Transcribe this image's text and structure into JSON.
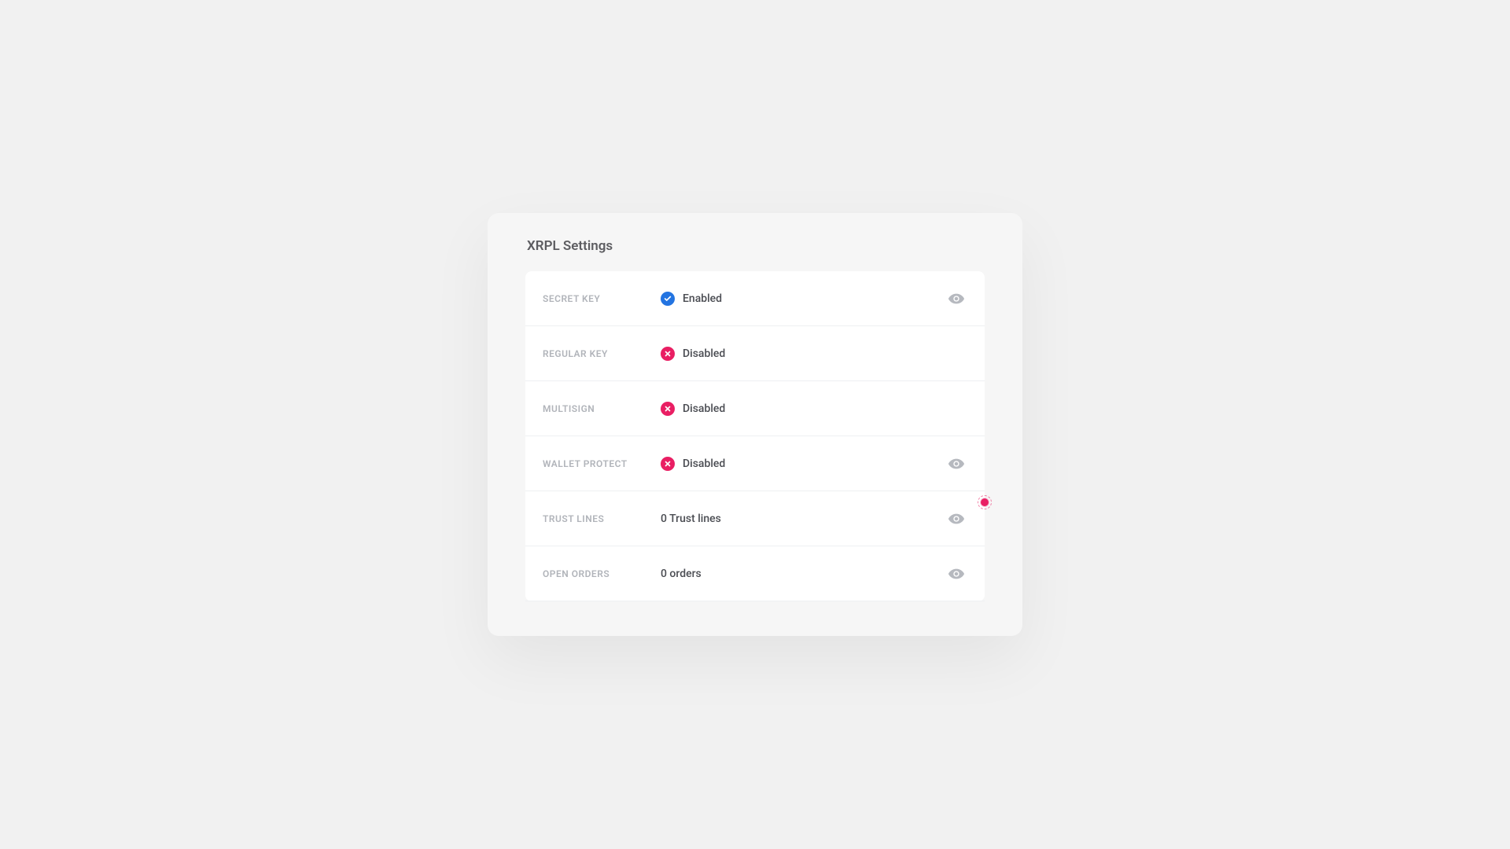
{
  "title": "XRPL Settings",
  "rows": [
    {
      "key": "secret-key",
      "label": "SECRET KEY",
      "status": "enabled",
      "statusText": "Enabled",
      "hasEye": true
    },
    {
      "key": "regular-key",
      "label": "REGULAR KEY",
      "status": "disabled",
      "statusText": "Disabled",
      "hasEye": false
    },
    {
      "key": "multisign",
      "label": "MULTISIGN",
      "status": "disabled",
      "statusText": "Disabled",
      "hasEye": false
    },
    {
      "key": "wallet-protect",
      "label": "WALLET PROTECT",
      "status": "disabled",
      "statusText": "Disabled",
      "hasEye": true
    },
    {
      "key": "trust-lines",
      "label": "TRUST LINES",
      "status": "none",
      "statusText": "0 Trust lines",
      "hasEye": true
    },
    {
      "key": "open-orders",
      "label": "OPEN ORDERS",
      "status": "none",
      "statusText": "0 orders",
      "hasEye": true
    }
  ],
  "colors": {
    "enabled": "#2374e1",
    "disabled": "#e91e63"
  }
}
